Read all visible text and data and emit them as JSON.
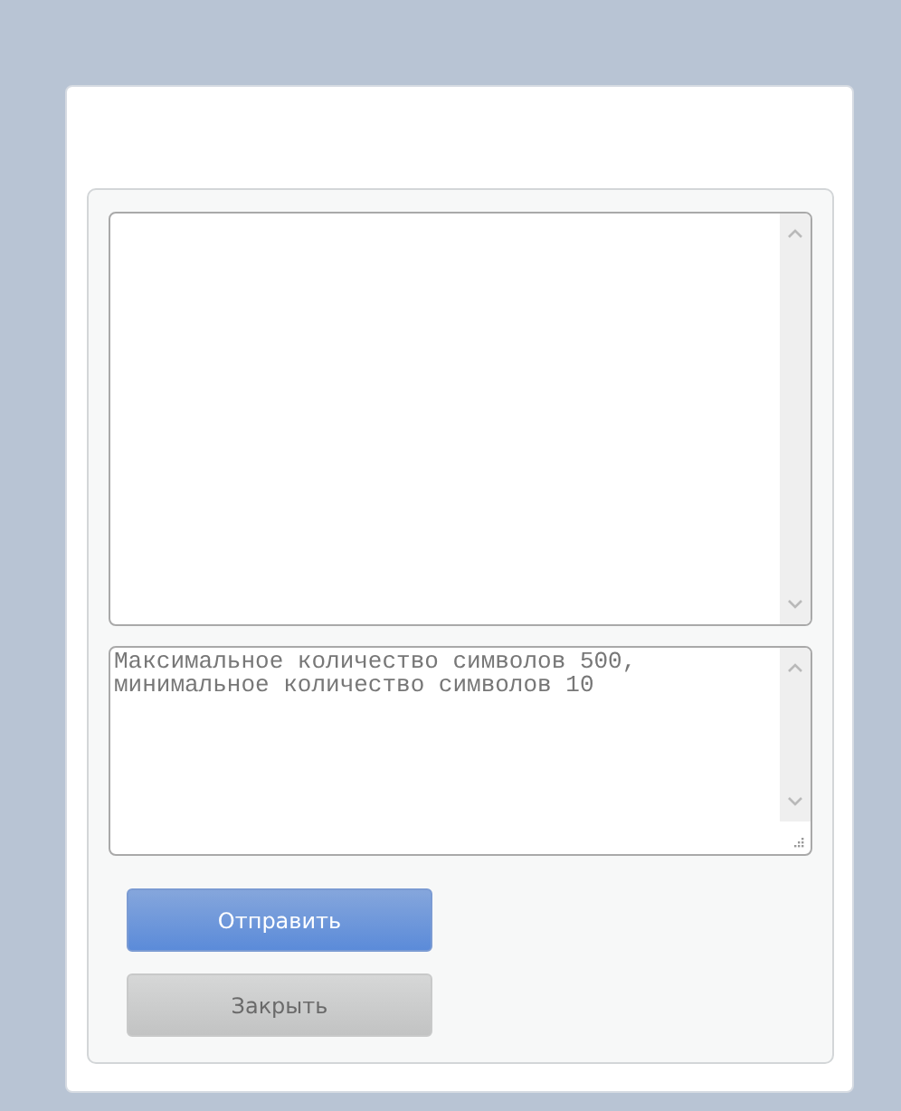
{
  "comment_field": {
    "placeholder": "Максимальное количество символов 500,\nминимальное количество символов 10"
  },
  "buttons": [
    {
      "label": "Отправить",
      "disabled": false
    },
    {
      "label": "Закрыть",
      "disabled": true
    }
  ]
}
